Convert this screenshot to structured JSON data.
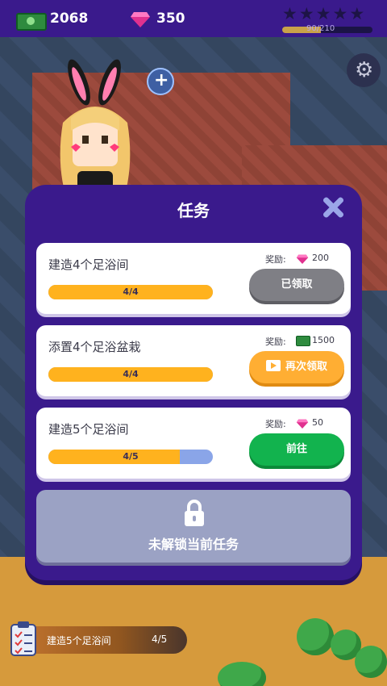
{
  "topbar": {
    "money": "2068",
    "gems": "350",
    "stars_total": 5,
    "xp_text": "90/210",
    "xp_fraction": 0.43
  },
  "icons": {
    "money": "cash-icon",
    "gem": "gem-icon",
    "settings": "gear-icon",
    "add": "plus-icon",
    "close": "close-icon",
    "lock": "lock-icon",
    "video": "video-icon",
    "clipboard": "clipboard-icon"
  },
  "colors": {
    "dialog": "#3a1a8c",
    "progress": "#ffb21e",
    "go_button": "#12b34e",
    "claim_button": "#ffae33",
    "done_button": "#7f7f85"
  },
  "dialog": {
    "title": "任务",
    "tasks": [
      {
        "name": "建造4个足浴间",
        "progress_text": "4/4",
        "progress_fraction": 1,
        "reward_label": "奖励:",
        "reward_type": "gem",
        "reward_value": "200",
        "button_label": "已领取"
      },
      {
        "name": "添置4个足浴盆栽",
        "progress_text": "4/4",
        "progress_fraction": 1,
        "reward_label": "奖励:",
        "reward_type": "cash",
        "reward_value": "1500",
        "button_label": "再次领取"
      },
      {
        "name": "建造5个足浴间",
        "progress_text": "4/5",
        "progress_fraction": 0.8,
        "reward_label": "奖励:",
        "reward_type": "gem",
        "reward_value": "50",
        "button_label": "前往"
      }
    ],
    "locked_text": "未解锁当前任务"
  },
  "bottom_task": {
    "name": "建造5个足浴间",
    "progress_text": "4/5"
  }
}
